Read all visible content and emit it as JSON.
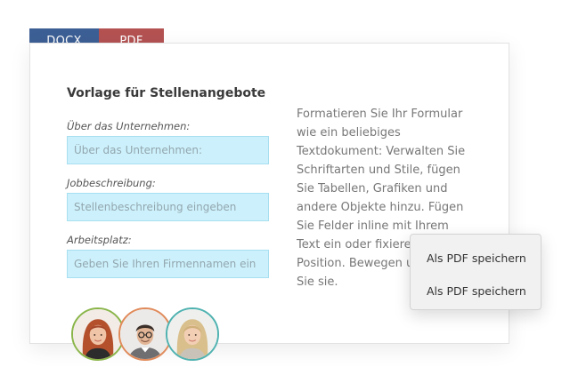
{
  "tabs": [
    {
      "label": "DOCX",
      "color": "#3c5f95"
    },
    {
      "label": "PDF",
      "color": "#b45252"
    }
  ],
  "form": {
    "title": "Vorlage für Stellenangebote",
    "fields": [
      {
        "label": "Über das Unternehmen:",
        "placeholder": "Über das Unternehmen:"
      },
      {
        "label": "Jobbeschreibung:",
        "placeholder": "Stellenbeschreibung eingeben"
      },
      {
        "label": "Arbeitsplatz:",
        "placeholder": "Geben Sie Ihren Firmennamen ein"
      }
    ],
    "input_bg": "#cdf1fc"
  },
  "description": "Formatieren Sie Ihr Formular wie ein beliebiges Textdokument: Verwalten Sie Schriftarten und Stile, fügen Sie Tabellen, Grafiken und andere Objekte hinzu. Fügen Sie Felder inline mit Ihrem Text ein oder fixieren Sie ihre Position. Bewegen und drehen Sie sie.",
  "context_menu": {
    "items": [
      "Als PDF speichern",
      "Als PDF speichern"
    ]
  },
  "avatars": [
    {
      "name": "avatar-woman-red-hair-icon",
      "border": "#8ab54a"
    },
    {
      "name": "avatar-man-glasses-icon",
      "border": "#e08a5a"
    },
    {
      "name": "avatar-woman-blonde-icon",
      "border": "#4fb2b0"
    }
  ]
}
